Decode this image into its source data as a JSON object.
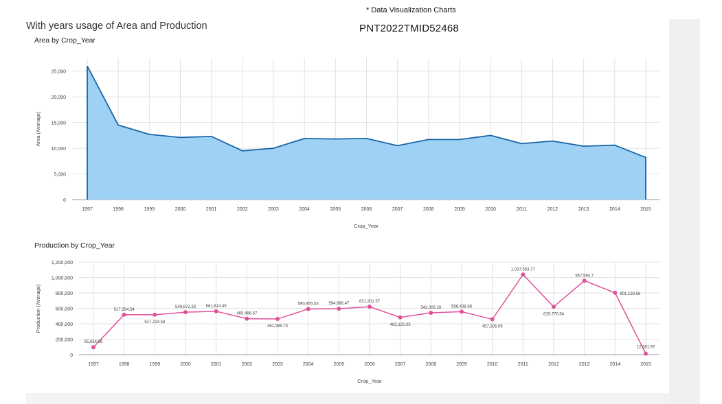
{
  "header": {
    "note": "* Data Visualization Charts",
    "project_id": "PNT2022TMID52468",
    "dashboard_title": "With years usage of Area and Production"
  },
  "colors": {
    "area_fill": "#9ed1f3",
    "area_line": "#1763a6",
    "production_line": "#e0519a",
    "grid": "#e2e2e2"
  },
  "chart_data": [
    {
      "type": "area",
      "title": "Area by Crop_Year",
      "xlabel": "Crop_Year",
      "ylabel": "Area (Average)",
      "ylim": [
        0,
        27500
      ],
      "yticks": [
        0,
        5000,
        10000,
        15000,
        20000,
        25000
      ],
      "ytick_labels": [
        "0",
        "5,000",
        "10,000",
        "15,000",
        "20,000",
        "25,000"
      ],
      "x": [
        "1997",
        "1998",
        "1999",
        "2000",
        "2001",
        "2002",
        "2003",
        "2004",
        "2005",
        "2006",
        "2007",
        "2008",
        "2009",
        "2010",
        "2011",
        "2012",
        "2013",
        "2014",
        "2015"
      ],
      "values": [
        26000,
        14500,
        12700,
        12100,
        12300,
        9500,
        10000,
        11900,
        11800,
        11900,
        10500,
        11700,
        11700,
        12500,
        10900,
        11400,
        10400,
        10600,
        8200
      ],
      "grid": true
    },
    {
      "type": "line",
      "title": "Production by Crop_Year",
      "xlabel": "Crop_Year",
      "ylabel": "Production (Average)",
      "ylim": [
        0,
        1200000
      ],
      "yticks": [
        0,
        200000,
        400000,
        600000,
        800000,
        1000000,
        1200000
      ],
      "ytick_labels": [
        "0",
        "200,000",
        "400,000",
        "600,000",
        "800,000",
        "1,000,000",
        "1,200,000"
      ],
      "x": [
        "1997",
        "1998",
        "1999",
        "2000",
        "2001",
        "2002",
        "2003",
        "2004",
        "2005",
        "2006",
        "2007",
        "2008",
        "2009",
        "2010",
        "2011",
        "2012",
        "2013",
        "2014",
        "2015"
      ],
      "values": [
        95654.69,
        517254.54,
        517214.53,
        549672.33,
        561614.45,
        465466.57,
        461985.73,
        590955.53,
        594996.47,
        621201.57,
        482125.05,
        542306.28,
        556438.88,
        457305.05,
        1037553.77,
        619770.54,
        957594.7,
        801159.56,
        12361.97
      ],
      "labels": [
        "95,654.69",
        "517,254.54",
        "517,214.53",
        "549,672.33",
        "561,614.45",
        "465,466.57",
        "461,985.73",
        "590,955.53",
        "594,996.47",
        "621,201.57",
        "482,125.05",
        "542,306.28",
        "556,438.88",
        "457,305.05",
        "1,037,553.77",
        "619,770.54",
        "957,594.7",
        "801,159.56",
        "12,361.97"
      ],
      "grid": true
    }
  ]
}
